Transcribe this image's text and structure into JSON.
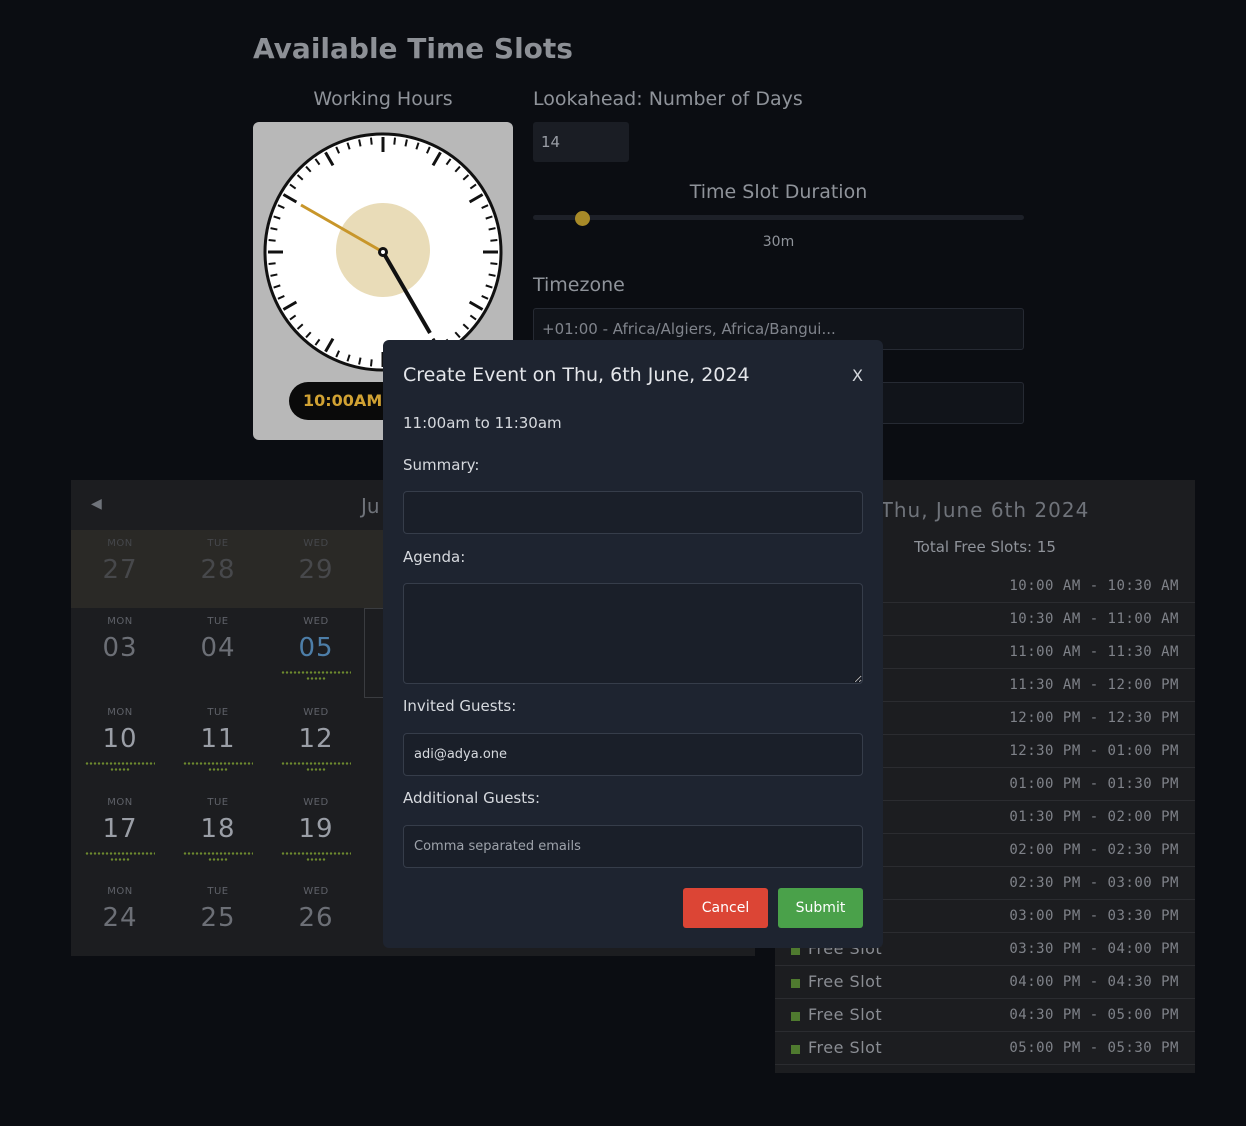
{
  "page": {
    "title": "Available Time Slots"
  },
  "working_hours": {
    "label": "Working Hours",
    "time_range": "10:00AM -"
  },
  "lookahead": {
    "label": "Lookahead: Number of Days",
    "value": "14"
  },
  "duration": {
    "label": "Time Slot Duration",
    "value": "30m",
    "slider_fraction": 0.1
  },
  "timezone": {
    "label": "Timezone",
    "value": "+01:00 - Africa/Algiers, Africa/Bangui..."
  },
  "calendar": {
    "month": "Ju",
    "days": [
      {
        "dow": "MON",
        "num": "27"
      },
      {
        "dow": "TUE",
        "num": "28"
      },
      {
        "dow": "WED",
        "num": "29"
      },
      {
        "dow": "MON",
        "num": "03"
      },
      {
        "dow": "TUE",
        "num": "04"
      },
      {
        "dow": "WED",
        "num": "05"
      },
      {
        "dow": "MON",
        "num": "10"
      },
      {
        "dow": "TUE",
        "num": "11"
      },
      {
        "dow": "WED",
        "num": "12"
      },
      {
        "dow": "MON",
        "num": "17"
      },
      {
        "dow": "TUE",
        "num": "18"
      },
      {
        "dow": "WED",
        "num": "19"
      },
      {
        "dow": "MON",
        "num": "24"
      },
      {
        "dow": "TUE",
        "num": "25"
      },
      {
        "dow": "WED",
        "num": "26"
      }
    ]
  },
  "slots": {
    "date": "Thu, June 6th 2024",
    "total": "Total Free Slots: 15",
    "items": [
      {
        "name": "",
        "time": "10:00 AM - 10:30 AM"
      },
      {
        "name": "",
        "time": "10:30 AM - 11:00 AM"
      },
      {
        "name": "",
        "time": "11:00 AM - 11:30 AM"
      },
      {
        "name": "",
        "time": "11:30 AM - 12:00 PM"
      },
      {
        "name": "",
        "time": "12:00 PM - 12:30 PM"
      },
      {
        "name": "",
        "time": "12:30 PM - 01:00 PM"
      },
      {
        "name": "",
        "time": "01:00 PM - 01:30 PM"
      },
      {
        "name": "",
        "time": "01:30 PM - 02:00 PM"
      },
      {
        "name": "",
        "time": "02:00 PM - 02:30 PM"
      },
      {
        "name": "",
        "time": "02:30 PM - 03:00 PM"
      },
      {
        "name": "",
        "time": "03:00 PM - 03:30 PM"
      },
      {
        "name": "Free Slot",
        "time": "03:30 PM - 04:00 PM"
      },
      {
        "name": "Free Slot",
        "time": "04:00 PM - 04:30 PM"
      },
      {
        "name": "Free Slot",
        "time": "04:30 PM - 05:00 PM"
      },
      {
        "name": "Free Slot",
        "time": "05:00 PM - 05:30 PM"
      }
    ]
  },
  "modal": {
    "title": "Create Event on Thu, 6th June, 2024",
    "close": "X",
    "time_range": "11:00am to 11:30am",
    "summary_label": "Summary:",
    "agenda_label": "Agenda:",
    "invited_label": "Invited Guests:",
    "invited_value": "adi@adya.one",
    "additional_label": "Additional Guests:",
    "additional_placeholder": "Comma separated emails",
    "cancel": "Cancel",
    "submit": "Submit"
  },
  "colors": {
    "accent": "#d1a233",
    "cancel": "#dc4535",
    "submit": "#4aa14a",
    "free_slot": "#4f7a2f"
  }
}
